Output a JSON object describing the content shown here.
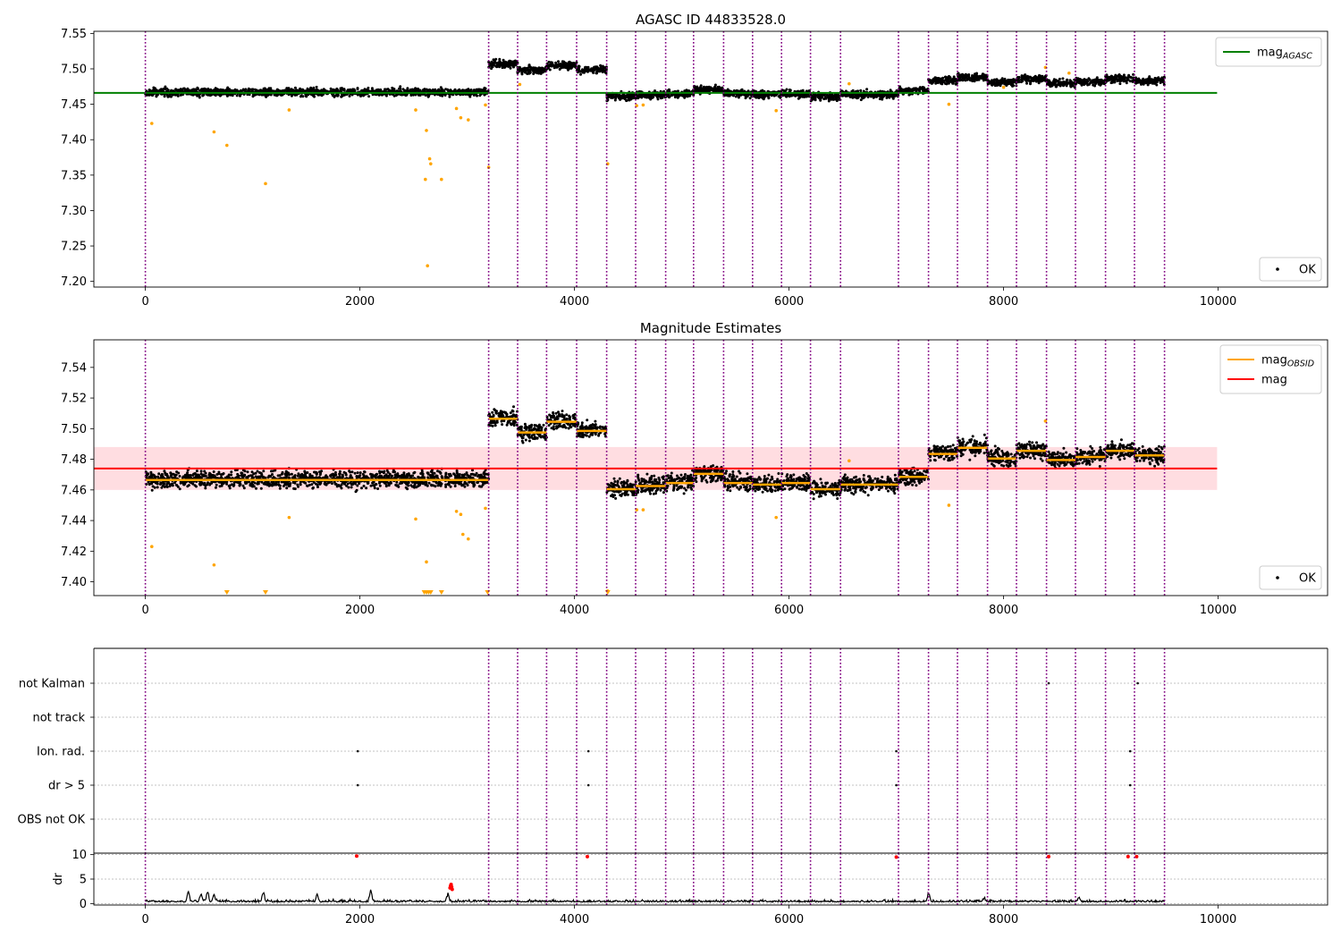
{
  "chart_data": [
    {
      "type": "scatter",
      "title": "AGASC ID 44833528.0",
      "xlim": [
        -480,
        11020
      ],
      "ylim": [
        7.192,
        7.553
      ],
      "yticks": [
        7.2,
        7.25,
        7.3,
        7.35,
        7.4,
        7.45,
        7.5,
        7.55
      ],
      "ytick_decimals": 2,
      "xticks": [
        0,
        2000,
        4000,
        6000,
        8000,
        10000
      ],
      "grid": false,
      "reference_lines": [
        {
          "label": "mag",
          "sub": "AGASC",
          "value": 7.466,
          "x_range": [
            -480,
            9990
          ],
          "color": "#008000"
        }
      ],
      "legend_upper": {
        "position": "upper right",
        "entries": [
          {
            "label": "mag",
            "sub": "AGASC",
            "color": "#008000",
            "kind": "line"
          }
        ]
      },
      "legend_lower": {
        "position": "lower right",
        "entries": [
          {
            "label": "OK",
            "color": "#000000",
            "kind": "dot"
          }
        ]
      },
      "outliers": [
        [
          60,
          7.423
        ],
        [
          640,
          7.411
        ],
        [
          760,
          7.392
        ],
        [
          1120,
          7.338
        ],
        [
          1340,
          7.442
        ],
        [
          2520,
          7.442
        ],
        [
          2620,
          7.413
        ],
        [
          2650,
          7.373
        ],
        [
          2660,
          7.366
        ],
        [
          2610,
          7.344
        ],
        [
          2760,
          7.344
        ],
        [
          2900,
          7.444
        ],
        [
          2940,
          7.431
        ],
        [
          3010,
          7.428
        ],
        [
          3170,
          7.449
        ],
        [
          3200,
          7.361
        ],
        [
          2630,
          7.222
        ],
        [
          3490,
          7.478
        ],
        [
          4310,
          7.366
        ],
        [
          4580,
          7.448
        ],
        [
          4640,
          7.449
        ],
        [
          5880,
          7.441
        ],
        [
          7490,
          7.45
        ],
        [
          8000,
          7.474
        ],
        [
          8390,
          7.502
        ],
        [
          8610,
          7.494
        ],
        [
          6560,
          7.479
        ]
      ]
    },
    {
      "type": "scatter",
      "title": "Magnitude Estimates",
      "xlim": [
        -480,
        11020
      ],
      "ylim": [
        7.391,
        7.558
      ],
      "yticks": [
        7.4,
        7.42,
        7.44,
        7.46,
        7.48,
        7.5,
        7.52,
        7.54
      ],
      "ytick_decimals": 2,
      "xticks": [
        0,
        2000,
        4000,
        6000,
        8000,
        10000
      ],
      "grid": false,
      "mag": {
        "label": "mag",
        "value": 7.474,
        "band": [
          7.46,
          7.488
        ],
        "color": "#ff0000",
        "band_color": "#ffdde1"
      },
      "legend_upper": {
        "position": "upper right",
        "entries": [
          {
            "label": "mag",
            "sub": "OBSID",
            "color": "#ffa500",
            "kind": "line"
          },
          {
            "label": "mag",
            "color": "#ff0000",
            "kind": "line"
          }
        ]
      },
      "legend_lower": {
        "position": "lower right",
        "entries": [
          {
            "label": "OK",
            "color": "#000000",
            "kind": "dot"
          }
        ]
      },
      "outliers": [
        [
          60,
          7.423
        ],
        [
          640,
          7.411
        ],
        [
          1340,
          7.442
        ],
        [
          2520,
          7.441
        ],
        [
          2620,
          7.413
        ],
        [
          2900,
          7.446
        ],
        [
          2940,
          7.444
        ],
        [
          2960,
          7.431
        ],
        [
          3010,
          7.428
        ],
        [
          3170,
          7.448
        ],
        [
          4580,
          7.447
        ],
        [
          4640,
          7.447
        ],
        [
          5880,
          7.442
        ],
        [
          7490,
          7.45
        ],
        [
          8390,
          7.505
        ],
        [
          6560,
          7.479
        ],
        [
          4310,
          7.394
        ]
      ],
      "below_range_marks": [
        760,
        1120,
        2600,
        2620,
        2640,
        2660,
        2760,
        3190,
        4310
      ]
    },
    {
      "type": "flags",
      "xlim": [
        -480,
        11020
      ],
      "xticks": [
        0,
        2000,
        4000,
        6000,
        8000,
        10000
      ],
      "categories": [
        "not Kalman",
        "not track",
        "Ion. rad.",
        "dr > 5",
        "OBS not OK"
      ],
      "points": [
        {
          "category": "not Kalman",
          "x": [
            8420,
            9250
          ]
        },
        {
          "category": "Ion. rad.",
          "x": [
            1980,
            4130,
            7000,
            9180
          ]
        },
        {
          "category": "dr > 5",
          "x": [
            1980,
            4130,
            7000,
            9180
          ]
        }
      ]
    },
    {
      "type": "line",
      "ylabel": "dr",
      "xlim": [
        -480,
        11020
      ],
      "ylim": [
        -0.3,
        10.3
      ],
      "yticks": [
        0,
        5,
        10
      ],
      "ytick_decimals": 0,
      "xticks": [
        0,
        2000,
        4000,
        6000,
        8000,
        10000
      ],
      "red_points": [
        [
          1970,
          9.7
        ],
        [
          4120,
          9.6
        ],
        [
          7000,
          9.5
        ],
        [
          8420,
          9.6
        ],
        [
          9160,
          9.6
        ],
        [
          9240,
          9.6
        ],
        [
          2840,
          3.2
        ],
        [
          2845,
          3.6
        ],
        [
          2850,
          3.9
        ],
        [
          2855,
          3.4
        ],
        [
          2860,
          2.9
        ]
      ]
    }
  ],
  "observations": [
    {
      "obsid": "50134",
      "start": 0,
      "end": 3200,
      "row": 2,
      "mean": 7.4665
    },
    {
      "obsid": "45474",
      "start": 3200,
      "end": 3470,
      "row": 1,
      "mean": 7.5065
    },
    {
      "obsid": "45473",
      "start": 3470,
      "end": 3740,
      "row": 0,
      "mean": 7.4975
    },
    {
      "obsid": "45472",
      "start": 3740,
      "end": 4020,
      "row": 2,
      "mean": 7.5045
    },
    {
      "obsid": "45471",
      "start": 4020,
      "end": 4300,
      "row": 1,
      "mean": 7.4985
    },
    {
      "obsid": "44658",
      "start": 4300,
      "end": 4570,
      "row": 0,
      "mean": 7.4605
    },
    {
      "obsid": "44657",
      "start": 4570,
      "end": 4850,
      "row": 2,
      "mean": 7.4625
    },
    {
      "obsid": "44649",
      "start": 4850,
      "end": 5110,
      "row": 1,
      "mean": 7.4645
    },
    {
      "obsid": "44648",
      "start": 5110,
      "end": 5390,
      "row": 0,
      "mean": 7.4705
    },
    {
      "obsid": "44638",
      "start": 5390,
      "end": 5660,
      "row": 2,
      "mean": 7.4645
    },
    {
      "obsid": "44637",
      "start": 5660,
      "end": 5930,
      "row": 1,
      "mean": 7.4635
    },
    {
      "obsid": "44614",
      "start": 5930,
      "end": 6200,
      "row": 0,
      "mean": 7.4645
    },
    {
      "obsid": "44613",
      "start": 6200,
      "end": 6480,
      "row": 2,
      "mean": 7.4605
    },
    {
      "obsid": "44605",
      "start": 6480,
      "end": 7020,
      "row": 1,
      "mean": 7.4635
    },
    {
      "obsid": "44604",
      "start": 7020,
      "end": 7300,
      "row": 0,
      "mean": 7.4685
    },
    {
      "obsid": "44515",
      "start": 7300,
      "end": 7570,
      "row": 2,
      "mean": 7.4835
    },
    {
      "obsid": "44514",
      "start": 7570,
      "end": 7850,
      "row": 1,
      "mean": 7.4875
    },
    {
      "obsid": "44513",
      "start": 7850,
      "end": 8120,
      "row": 0,
      "mean": 7.4805
    },
    {
      "obsid": "44512",
      "start": 8120,
      "end": 8400,
      "row": 2,
      "mean": 7.4855
    },
    {
      "obsid": "44503",
      "start": 8400,
      "end": 8670,
      "row": 1,
      "mean": 7.4795
    },
    {
      "obsid": "44502",
      "start": 8670,
      "end": 8950,
      "row": 0,
      "mean": 7.4815
    },
    {
      "obsid": "44501",
      "start": 8950,
      "end": 9220,
      "row": 2,
      "mean": 7.4855
    },
    {
      "obsid": "44500",
      "start": 9220,
      "end": 9500,
      "row": 1,
      "mean": 7.4825
    }
  ],
  "colors": {
    "boundary": "#800080",
    "obsid_mean": "#ffa500",
    "outlier": "#ffa500",
    "ok": "#000000",
    "dr_flag": "#ff0000"
  }
}
